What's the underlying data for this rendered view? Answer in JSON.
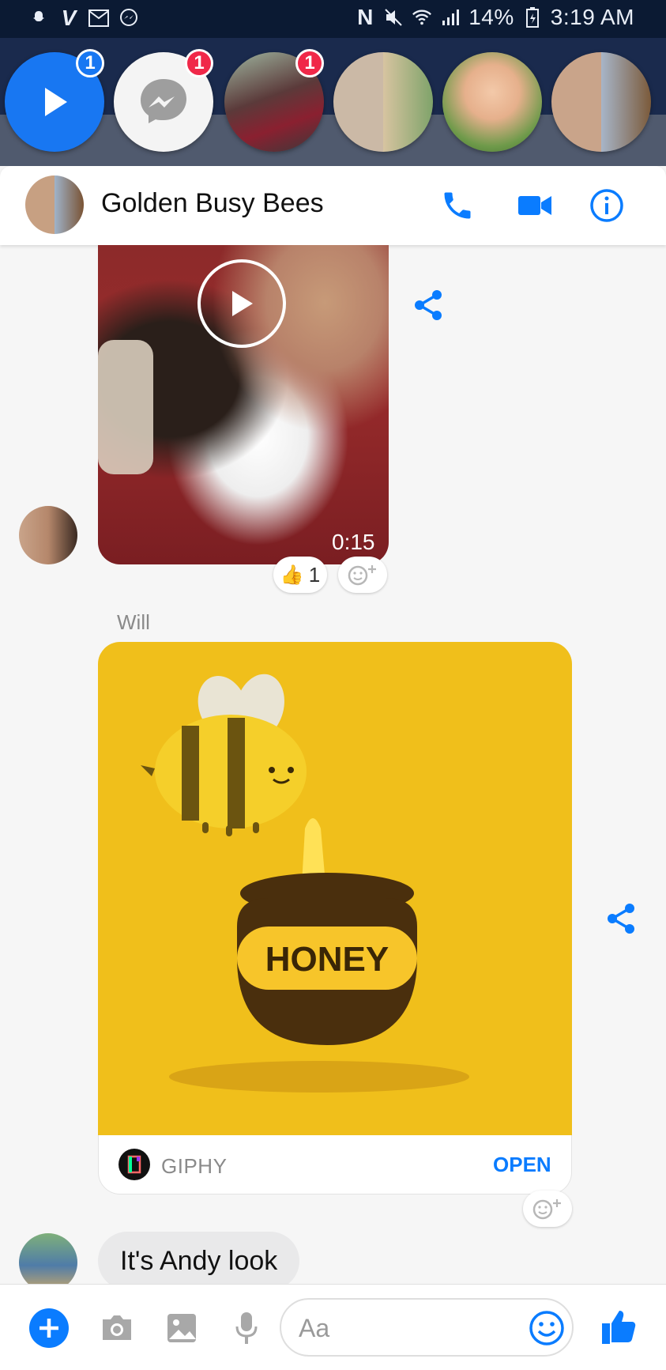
{
  "status_bar": {
    "battery": "14%",
    "time": "3:19 AM",
    "left_icons": [
      "snapchat-icon",
      "venmo-icon",
      "gmail-icon",
      "messenger-icon"
    ],
    "right_icons": [
      "nfc-icon",
      "mute-icon",
      "wifi-icon",
      "signal-icon",
      "battery-icon"
    ]
  },
  "chat_heads": [
    {
      "name": "video-play",
      "badge": "1",
      "badge_color": "#1877f2"
    },
    {
      "name": "messenger",
      "badge": "1",
      "badge_color": "#f02849"
    },
    {
      "name": "group-photo",
      "badge": "1",
      "badge_color": "#f02849"
    },
    {
      "name": "collage-photo",
      "badge": "",
      "badge_color": ""
    },
    {
      "name": "boy-photo",
      "badge": "",
      "badge_color": ""
    },
    {
      "name": "golden-busy-bees",
      "badge": "",
      "badge_color": ""
    }
  ],
  "header": {
    "title": "Golden Busy Bees",
    "actions": [
      "phone-icon",
      "video-camera-icon",
      "info-icon"
    ]
  },
  "messages": {
    "video": {
      "duration": "0:15",
      "reaction_emoji": "👍",
      "reaction_count": "1"
    },
    "sender_name": "Will",
    "gif": {
      "text": "HONEY",
      "source": "GIPHY",
      "open_label": "OPEN"
    },
    "text_bubble": "It's Andy look"
  },
  "composer": {
    "placeholder": "Aa",
    "icons": [
      "plus-icon",
      "camera-icon",
      "image-icon",
      "microphone-icon",
      "emoji-icon",
      "thumbs-up-icon"
    ]
  },
  "colors": {
    "accent": "#0a7cff",
    "statusbar": "#0b1a33",
    "gif_bg": "#f0bf1b"
  }
}
